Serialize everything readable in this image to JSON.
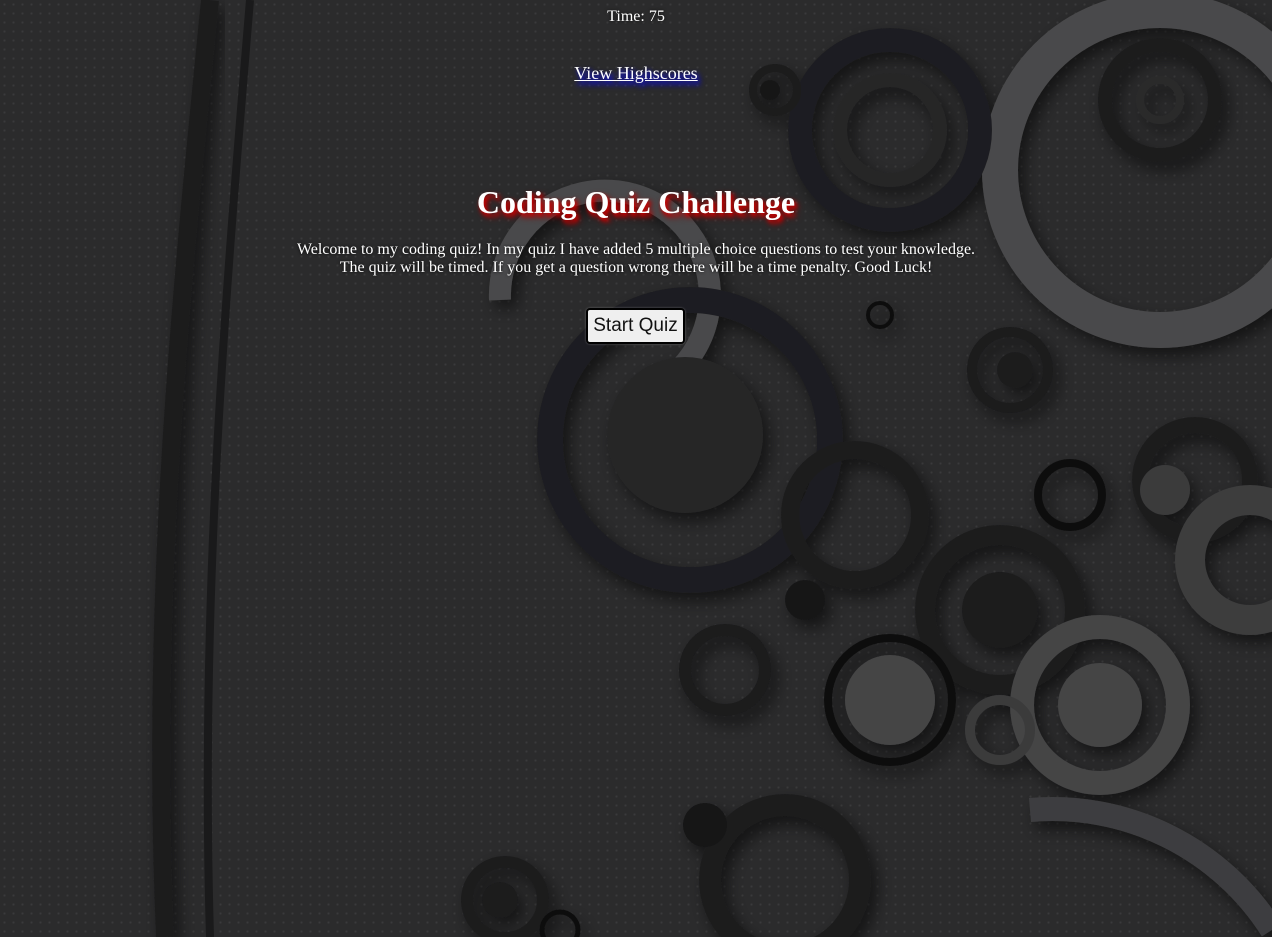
{
  "header": {
    "timer_label": "Time:",
    "timer_value": "75",
    "highscores_link": "View Highscores"
  },
  "main": {
    "title": "Coding Quiz Challenge",
    "intro_line1": "Welcome to my coding quiz! In my quiz I have added 5 multiple choice questions to test your knowledge.",
    "intro_line2": "The quiz will be timed. If you get a question wrong there will be a time penalty. Good Luck!",
    "start_button": "Start Quiz"
  },
  "colors": {
    "background": "#2b2b2c",
    "text": "#ffffff",
    "title_glow": "#d40000",
    "link_glow": "#1b1bd0"
  }
}
